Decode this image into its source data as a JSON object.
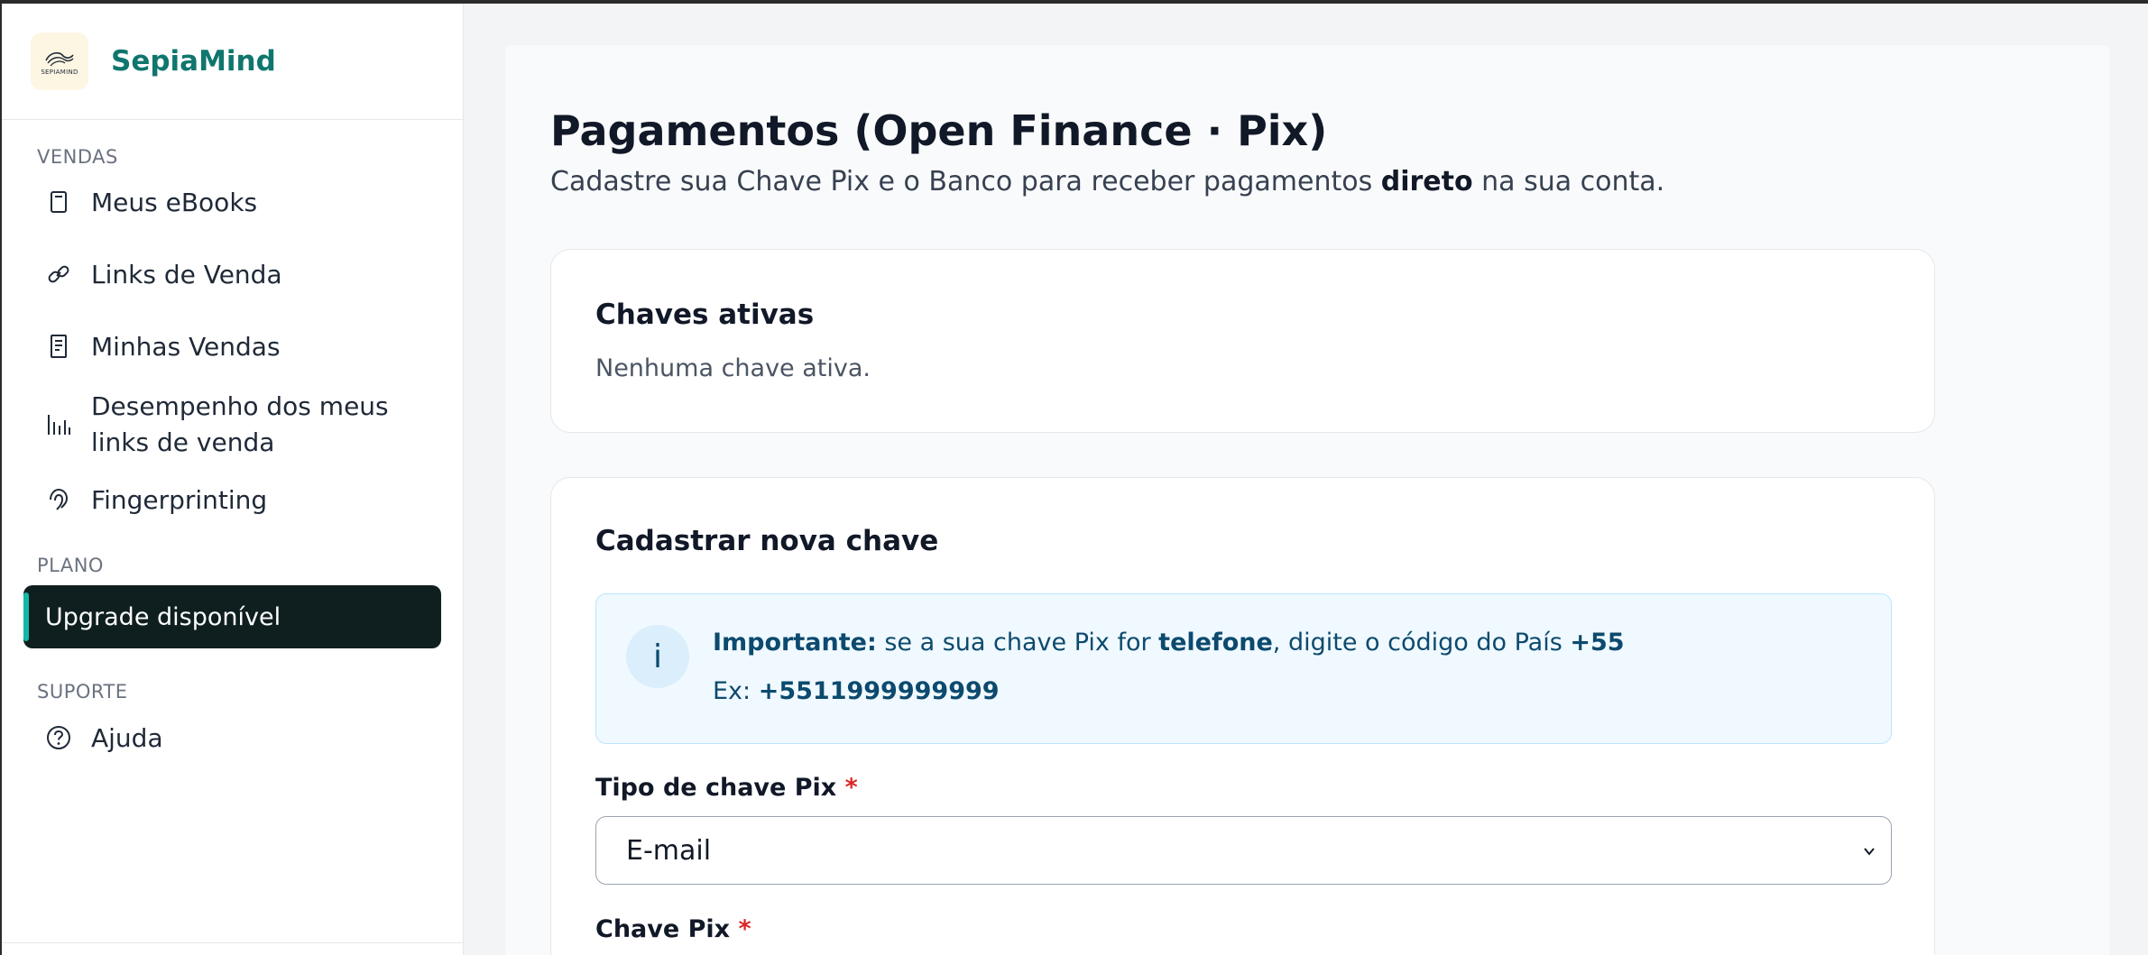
{
  "brand": {
    "name": "SepiaMind",
    "logo_text": "SEPIAMIND"
  },
  "sidebar": {
    "sections": [
      {
        "label": "VENDAS",
        "items": [
          {
            "label": "Meus eBooks",
            "icon": "book-icon"
          },
          {
            "label": "Links de Venda",
            "icon": "link-icon"
          },
          {
            "label": "Minhas Vendas",
            "icon": "receipt-icon"
          },
          {
            "label": "Desempenho dos meus links de venda",
            "icon": "bar-chart-icon"
          },
          {
            "label": "Fingerprinting",
            "icon": "fingerprint-icon"
          }
        ]
      },
      {
        "label": "PLANO",
        "items": [
          {
            "label": "Upgrade disponível",
            "active": true
          }
        ]
      },
      {
        "label": "SUPORTE",
        "items": [
          {
            "label": "Ajuda",
            "icon": "help-circle-icon"
          }
        ]
      }
    ]
  },
  "page": {
    "title": "Pagamentos (Open Finance · Pix)",
    "subtitle_pre": "Cadastre sua Chave Pix e o Banco para receber pagamentos ",
    "subtitle_bold": "direto",
    "subtitle_post": " na sua conta."
  },
  "active_keys": {
    "title": "Chaves ativas",
    "empty_text": "Nenhuma chave ativa."
  },
  "new_key": {
    "title": "Cadastrar nova chave",
    "info": {
      "icon_glyph": "i",
      "bold1": "Importante:",
      "text1": " se a sua chave Pix for ",
      "bold2": "telefone",
      "text2": ", digite o código do País ",
      "bold3": "+55",
      "text3": "Ex: ",
      "bold4": "+5511999999999"
    },
    "type_label": "Tipo de chave Pix",
    "type_value": "E-mail",
    "key_label": "Chave Pix",
    "required_mark": "*"
  },
  "colors": {
    "brand": "#0f766e",
    "active_bg": "#0f1f1f",
    "accent": "#14b8a6",
    "info_bg": "#f0f9ff",
    "info_text": "#0c4a6e",
    "required": "#dc2626"
  }
}
